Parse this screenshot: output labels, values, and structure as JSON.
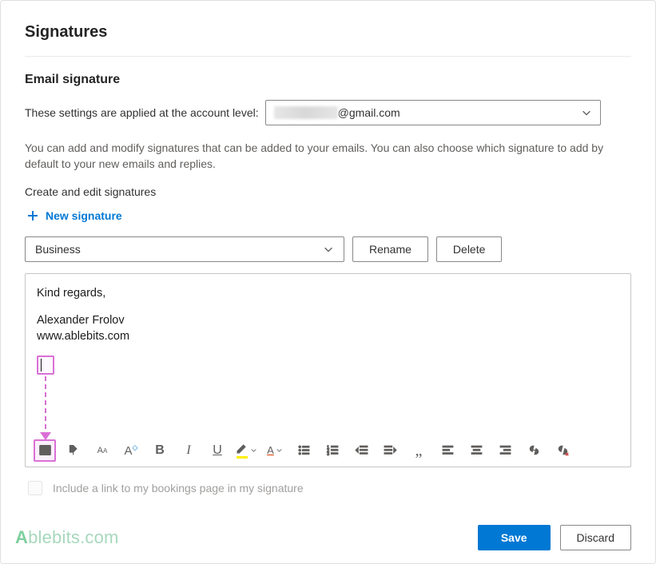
{
  "header": {
    "page_title": "Signatures",
    "section_title": "Email signature"
  },
  "account": {
    "label": "These settings are applied at the account level:",
    "domain_suffix": "@gmail.com"
  },
  "help_text": "You can add and modify signatures that can be added to your emails. You can also choose which signature to add by default to your new emails and replies.",
  "create_edit_label": "Create and edit signatures",
  "new_signature_label": "New signature",
  "signature_select": {
    "selected": "Business"
  },
  "buttons": {
    "rename": "Rename",
    "delete": "Delete",
    "save": "Save",
    "discard": "Discard"
  },
  "editor": {
    "line1": "Kind regards,",
    "line2": "Alexander Frolov",
    "line3": "www.ablebits.com"
  },
  "bookings_checkbox_label": "Include a link to my bookings page in my signature",
  "watermark": {
    "a": "A",
    "rest": "blebits.com"
  },
  "icons": {
    "image": "image-icon",
    "format_painter": "format-painter-icon",
    "font_family": "font-family-icon",
    "font_size": "font-size-icon",
    "bold": "bold-icon",
    "italic": "italic-icon",
    "underline": "underline-icon",
    "highlight": "highlight-icon",
    "font_color": "font-color-icon",
    "bullets": "bullets-icon",
    "numbering": "numbering-icon",
    "outdent": "outdent-icon",
    "indent": "indent-icon",
    "quote": "quote-icon",
    "align_left": "align-left-icon",
    "align_center": "align-center-icon",
    "align_right": "align-right-icon",
    "link": "link-icon",
    "unlink": "unlink-icon"
  }
}
